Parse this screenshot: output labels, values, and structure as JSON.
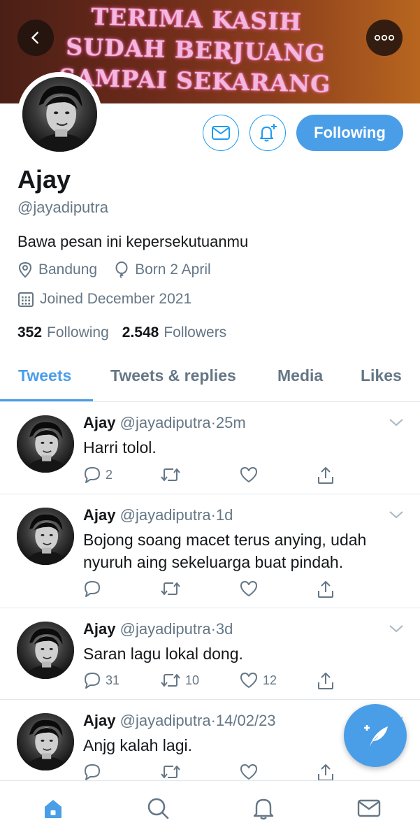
{
  "banner": {
    "text": "TERIMA KASIH SUDAH BERJUANG SAMPAI SEKARANG"
  },
  "header": {
    "back_icon": "chevron-left-icon",
    "more_icon": "more-horizontal-icon"
  },
  "profile": {
    "name": "Ajay",
    "handle": "@jayadiputra",
    "bio": "Bawa pesan ini kepersekutuanmu",
    "location": "Bandung",
    "birthday": "Born 2 April",
    "joined": "Joined December 2021",
    "following_count": "352",
    "following_label": "Following",
    "followers_count": "2.548",
    "followers_label": "Followers",
    "follow_button_label": "Following"
  },
  "tabs": [
    "Tweets",
    "Tweets & replies",
    "Media",
    "Likes"
  ],
  "active_tab": "Tweets",
  "tweets": [
    {
      "name": "Ajay",
      "handle": "@jayadiputra",
      "sep": "·",
      "time": "25m",
      "text": "Harri tolol.",
      "replies": "2",
      "retweets": "",
      "likes": ""
    },
    {
      "name": "Ajay",
      "handle": "@jayadiputra",
      "sep": "·",
      "time": "1d",
      "text": "Bojong soang macet terus anying, udah nyuruh aing sekeluarga buat pindah.",
      "replies": "",
      "retweets": "",
      "likes": ""
    },
    {
      "name": "Ajay",
      "handle": "@jayadiputra",
      "sep": "·",
      "time": "3d",
      "text": "Saran lagu lokal dong.",
      "replies": "31",
      "retweets": "10",
      "likes": "12"
    },
    {
      "name": "Ajay",
      "handle": "@jayadiputra",
      "sep": "·",
      "time": "14/02/23",
      "text": "Anjg kalah lagi.",
      "replies": "",
      "retweets": "",
      "likes": ""
    }
  ],
  "colors": {
    "accent": "#4a9ee8",
    "text": "#14171a",
    "muted": "#657786",
    "border": "#e1e8ed"
  },
  "nav": [
    "home-icon",
    "search-icon",
    "notifications-icon",
    "messages-icon"
  ]
}
